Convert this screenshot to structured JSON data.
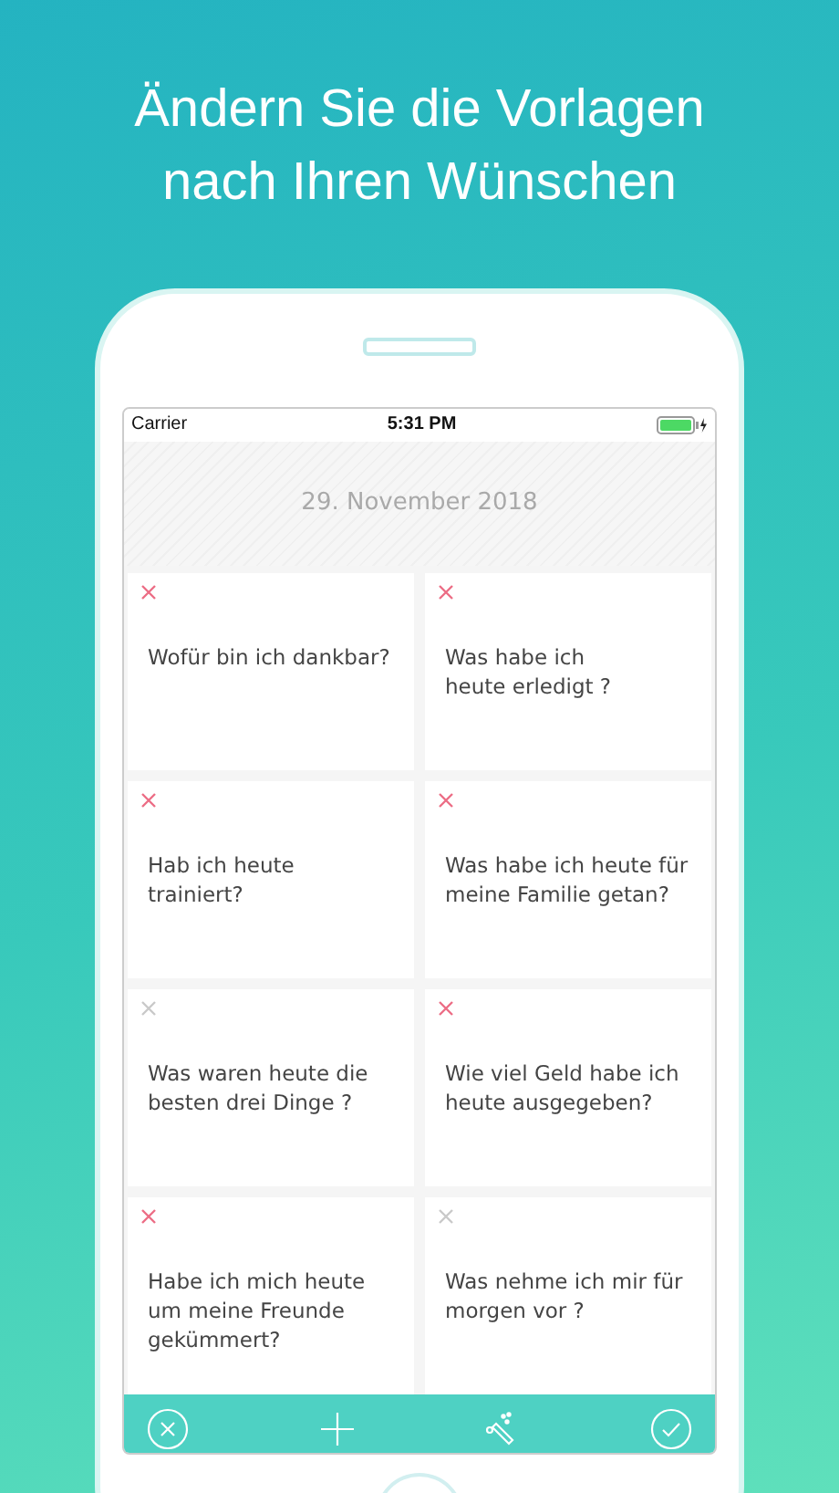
{
  "headline": "Ändern Sie die Vorlagen nach Ihren Wünschen",
  "status_bar": {
    "carrier": "Carrier",
    "time": "5:31 PM"
  },
  "date": "29. November 2018",
  "cards": [
    {
      "text": "Wofür bin ich dankbar?",
      "selected": true
    },
    {
      "text": "Was habe ich\nheute erledigt ?",
      "selected": true
    },
    {
      "text": "Hab ich heute\ntrainiert?",
      "selected": true
    },
    {
      "text": "Was habe ich heute für\nmeine Familie getan?",
      "selected": true
    },
    {
      "text": "Was waren heute die\nbesten drei Dinge ?",
      "selected": false
    },
    {
      "text": "Wie viel Geld habe ich\nheute ausgegeben?",
      "selected": true
    },
    {
      "text": "Habe ich mich heute\num meine Freunde\ngekümmert?",
      "selected": true
    },
    {
      "text": "Was nehme ich mir für\nmorgen vor ?",
      "selected": false
    }
  ],
  "toolbar": [
    {
      "kind": "cancel"
    },
    {
      "kind": "add"
    },
    {
      "kind": "magic"
    },
    {
      "kind": "confirm"
    }
  ]
}
